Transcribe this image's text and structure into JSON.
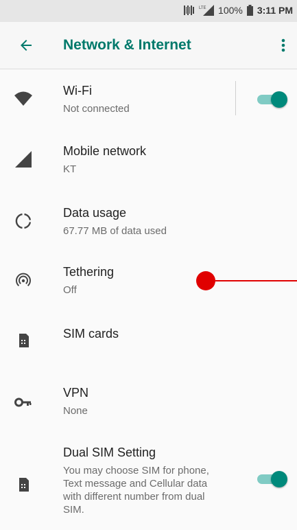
{
  "status_bar": {
    "battery_percent": "100%",
    "time": "3:11 PM",
    "network_label": "LTE"
  },
  "app_bar": {
    "title": "Network & Internet",
    "back_icon": "arrow-back-icon",
    "menu_icon": "more-vert-icon"
  },
  "items": [
    {
      "title": "Wi-Fi",
      "subtitle": "Not connected",
      "icon": "wifi-icon",
      "toggle": true
    },
    {
      "title": "Mobile network",
      "subtitle": "KT",
      "icon": "signal-icon"
    },
    {
      "title": "Data usage",
      "subtitle": "67.77 MB of data used",
      "icon": "data-usage-icon"
    },
    {
      "title": "Tethering",
      "subtitle": "Off",
      "icon": "hotspot-icon"
    },
    {
      "title": "SIM cards",
      "icon": "sim-card-icon"
    },
    {
      "title": "VPN",
      "subtitle": "None",
      "icon": "vpn-key-icon"
    },
    {
      "title": "Dual SIM Setting",
      "subtitle_lines": [
        "You may choose SIM for phone,",
        "Text message and Cellular data",
        "with different number from dual",
        "SIM."
      ],
      "icon": "sim-card-icon",
      "toggle": true
    }
  ],
  "colors": {
    "accent": "#00796b",
    "switch_thumb": "#00897b",
    "switch_track": "#80cbc4",
    "annotation": "#e00000"
  }
}
